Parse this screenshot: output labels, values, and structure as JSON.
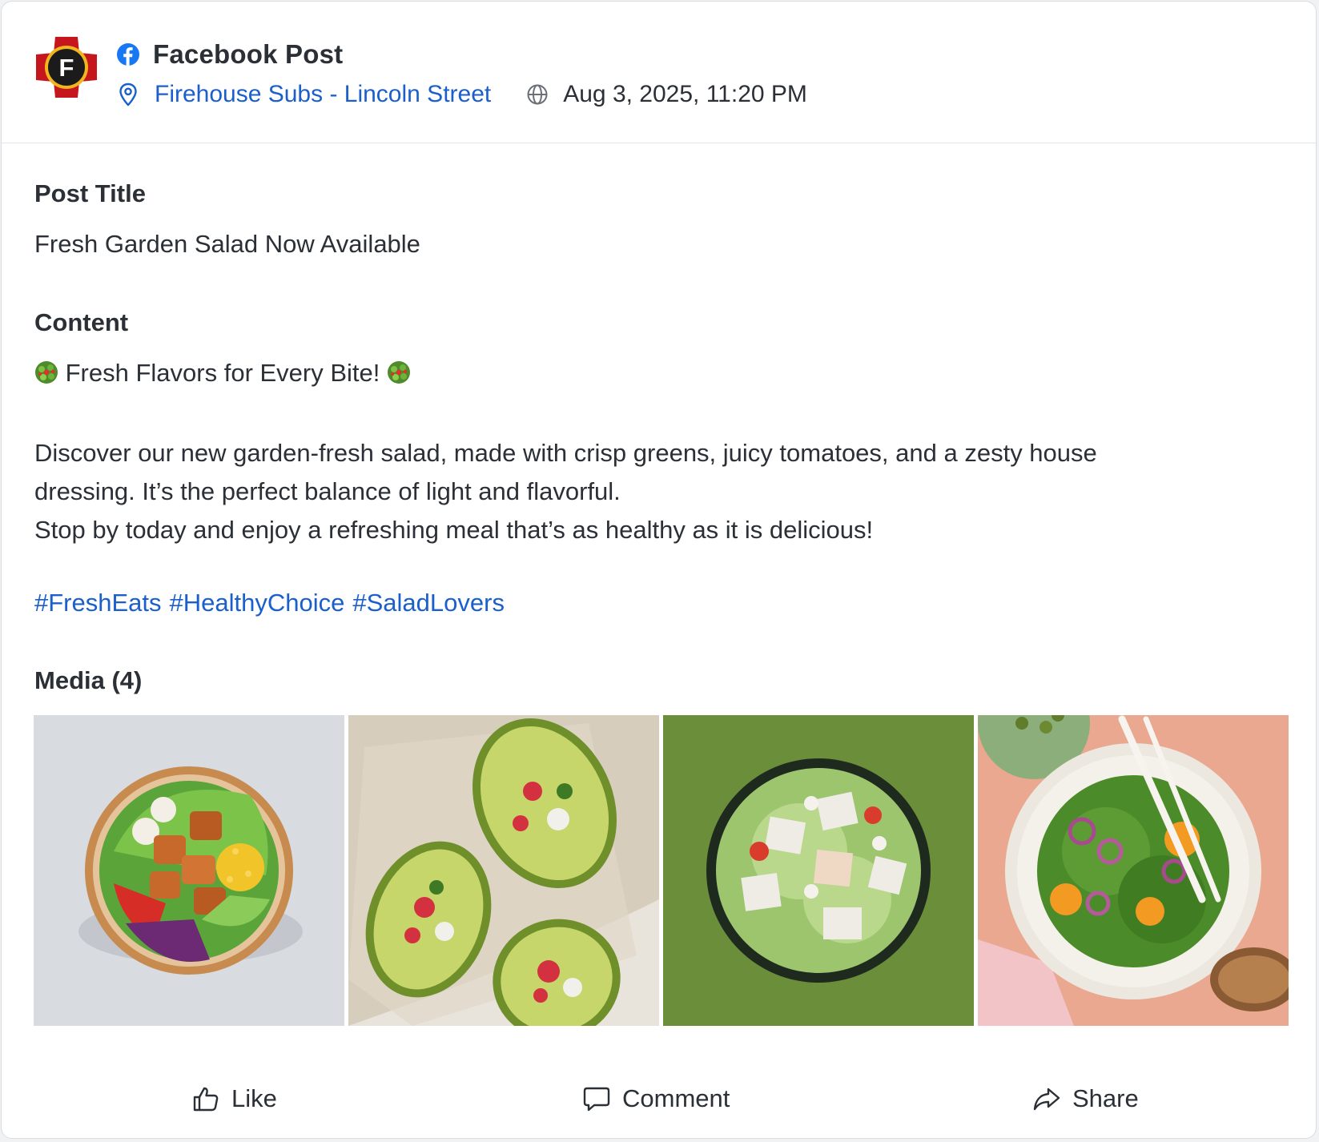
{
  "header": {
    "title": "Facebook Post",
    "location": "Firehouse Subs - Lincoln Street",
    "datetime": "Aug 3, 2025, 11:20 PM",
    "logo_letter": "F",
    "network_icon": "facebook-icon"
  },
  "post": {
    "title_label": "Post Title",
    "title": "Fresh Garden Salad Now Available",
    "content_label": "Content",
    "content_headline": "Fresh Flavors for Every Bite!",
    "content_headline_emoji": "salad-emoji",
    "content_lines": [
      "Discover our new garden-fresh salad, made with crisp greens, juicy tomatoes, and a zesty house",
      "dressing. It’s the perfect balance of light and flavorful.",
      "Stop by today and enjoy a refreshing meal that’s as healthy as it is delicious!"
    ],
    "hashtags": [
      "#FreshEats",
      "#HealthyChoice",
      "#SaladLovers"
    ]
  },
  "media": {
    "label": "Media (4)",
    "items": [
      "salad-bowl-photo",
      "stuffed-avocado-photo",
      "green-salad-bowl-photo",
      "arugula-orange-salad-photo"
    ]
  },
  "actions": {
    "like": "Like",
    "comment": "Comment",
    "share": "Share"
  },
  "colors": {
    "link": "#1a5fcc",
    "text": "#2b2f36",
    "border": "#e1e4e8",
    "logo_red": "#c4161c",
    "facebook_blue": "#1877f2"
  }
}
